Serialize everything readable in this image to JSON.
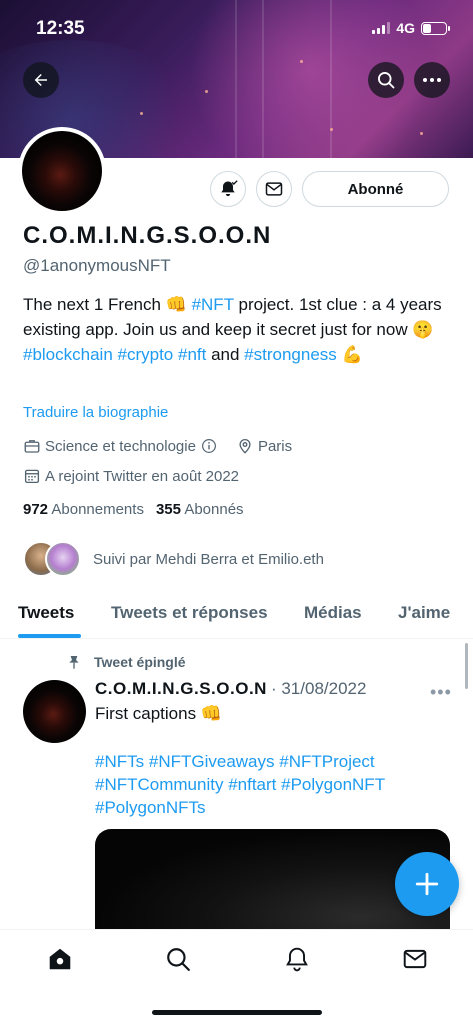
{
  "status_bar": {
    "time": "12:35",
    "network": "4G"
  },
  "header": {
    "back_icon": "back-arrow-icon",
    "search_icon": "search-icon",
    "more_icon": "more-icon"
  },
  "profile": {
    "follow_button": "Abonné",
    "name": "C.O.M.I.N.G.S.O.O.N",
    "handle": "@1anonymousNFT",
    "bio": {
      "part1": "The next 1 French 👊 ",
      "tag1": "#NFT",
      "part2": " project. 1st clue : a 4 years existing app. Join us and keep it secret just for now 🤫 ",
      "tag2": "#blockchain",
      "tag3": "#crypto",
      "tag4": "#nft",
      "part3": " and ",
      "tag5": "#strongness",
      "part4": " 💪"
    },
    "translate": "Traduire la biographie",
    "category": "Science et technologie",
    "location": "Paris",
    "joined": "A rejoint Twitter en août 2022",
    "following_count": "972",
    "following_label": "Abonnements",
    "followers_count": "355",
    "followers_label": "Abonnés",
    "followed_by": "Suivi par Mehdi Berra et Emilio.eth"
  },
  "tabs": [
    "Tweets",
    "Tweets et réponses",
    "Médias",
    "J'aime"
  ],
  "tweet": {
    "pinned_label": "Tweet épinglé",
    "author": "C.O.M.I.N.G.S.O.O.N",
    "date": "· 31/08/2022",
    "text": "First captions 👊",
    "hashtags": [
      "#NFTs",
      "#NFTGiveaways",
      "#NFTProject",
      "#NFTCommunity",
      "#nftart",
      "#PolygonNFT",
      "#PolygonNFTs"
    ]
  },
  "colors": {
    "accent": "#1d9bf0",
    "text": "#0f1419",
    "muted": "#536471"
  }
}
